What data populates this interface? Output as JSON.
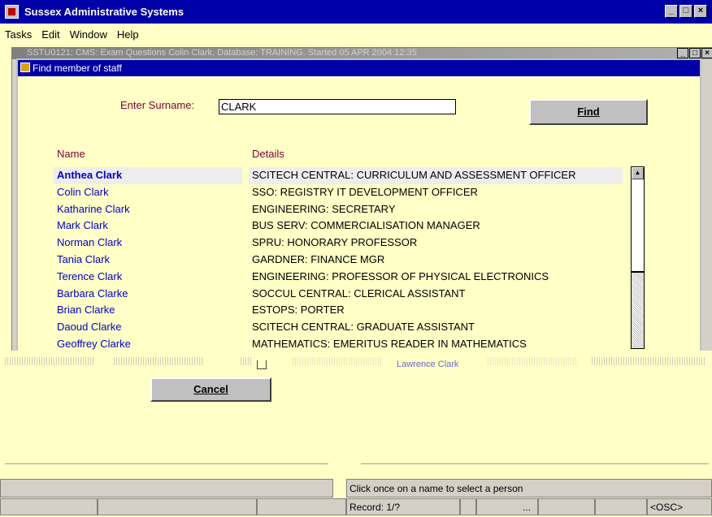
{
  "app": {
    "title": "Sussex Administrative Systems"
  },
  "menu": [
    {
      "label": "Tasks"
    },
    {
      "label": "Edit"
    },
    {
      "label": "Window"
    },
    {
      "label": "Help"
    }
  ],
  "background_window": {
    "title": "SSTU0121: CMS: Exam Questions Colin Clark. Database: TRAINING. Started 05 APR 2004 12:35"
  },
  "dialog": {
    "title": "Find member of staff",
    "surname_label": "Enter Surname:",
    "surname_value": "CLARK",
    "find_label": "Find",
    "cancel_label": "Cancel",
    "name_header": "Name",
    "details_header": "Details",
    "rows": [
      {
        "name": "Anthea Clark",
        "details": "SCITECH CENTRAL: CURRICULUM AND ASSESSMENT OFFICER"
      },
      {
        "name": "Colin Clark",
        "details": "SSO: REGISTRY IT DEVELOPMENT OFFICER"
      },
      {
        "name": "Katharine Clark",
        "details": "ENGINEERING: SECRETARY"
      },
      {
        "name": "Mark Clark",
        "details": "BUS SERV: COMMERCIALISATION  MANAGER"
      },
      {
        "name": "Norman Clark",
        "details": "SPRU: HONORARY PROFESSOR"
      },
      {
        "name": "Tania Clark",
        "details": "GARDNER: FINANCE MGR"
      },
      {
        "name": "Terence Clark",
        "details": "ENGINEERING: PROFESSOR OF PHYSICAL ELECTRONICS"
      },
      {
        "name": "Barbara Clarke",
        "details": "SOCCUL CENTRAL: CLERICAL ASSISTANT"
      },
      {
        "name": "Brian Clarke",
        "details": "ESTOPS: PORTER"
      },
      {
        "name": "Daoud Clarke",
        "details": "SCITECH CENTRAL: GRADUATE ASSISTANT"
      },
      {
        "name": "Geoffrey Clarke",
        "details": "MATHEMATICS: EMERITUS READER IN MATHEMATICS"
      }
    ],
    "partial_row": "Lawrence Clark"
  },
  "status": {
    "message": "Click once on a name to select a person",
    "record": "Record: 1/?",
    "ellipsis": "...",
    "mode": "<OSC>"
  },
  "colors": {
    "titlebar": "#0000a8",
    "background": "#ffffc6",
    "name_link": "#0000cc",
    "label": "#800040"
  },
  "icons": [
    "app-icon",
    "minimize-icon",
    "maximize-icon",
    "close-icon",
    "dialog-icon",
    "scroll-up-arrow-icon"
  ]
}
